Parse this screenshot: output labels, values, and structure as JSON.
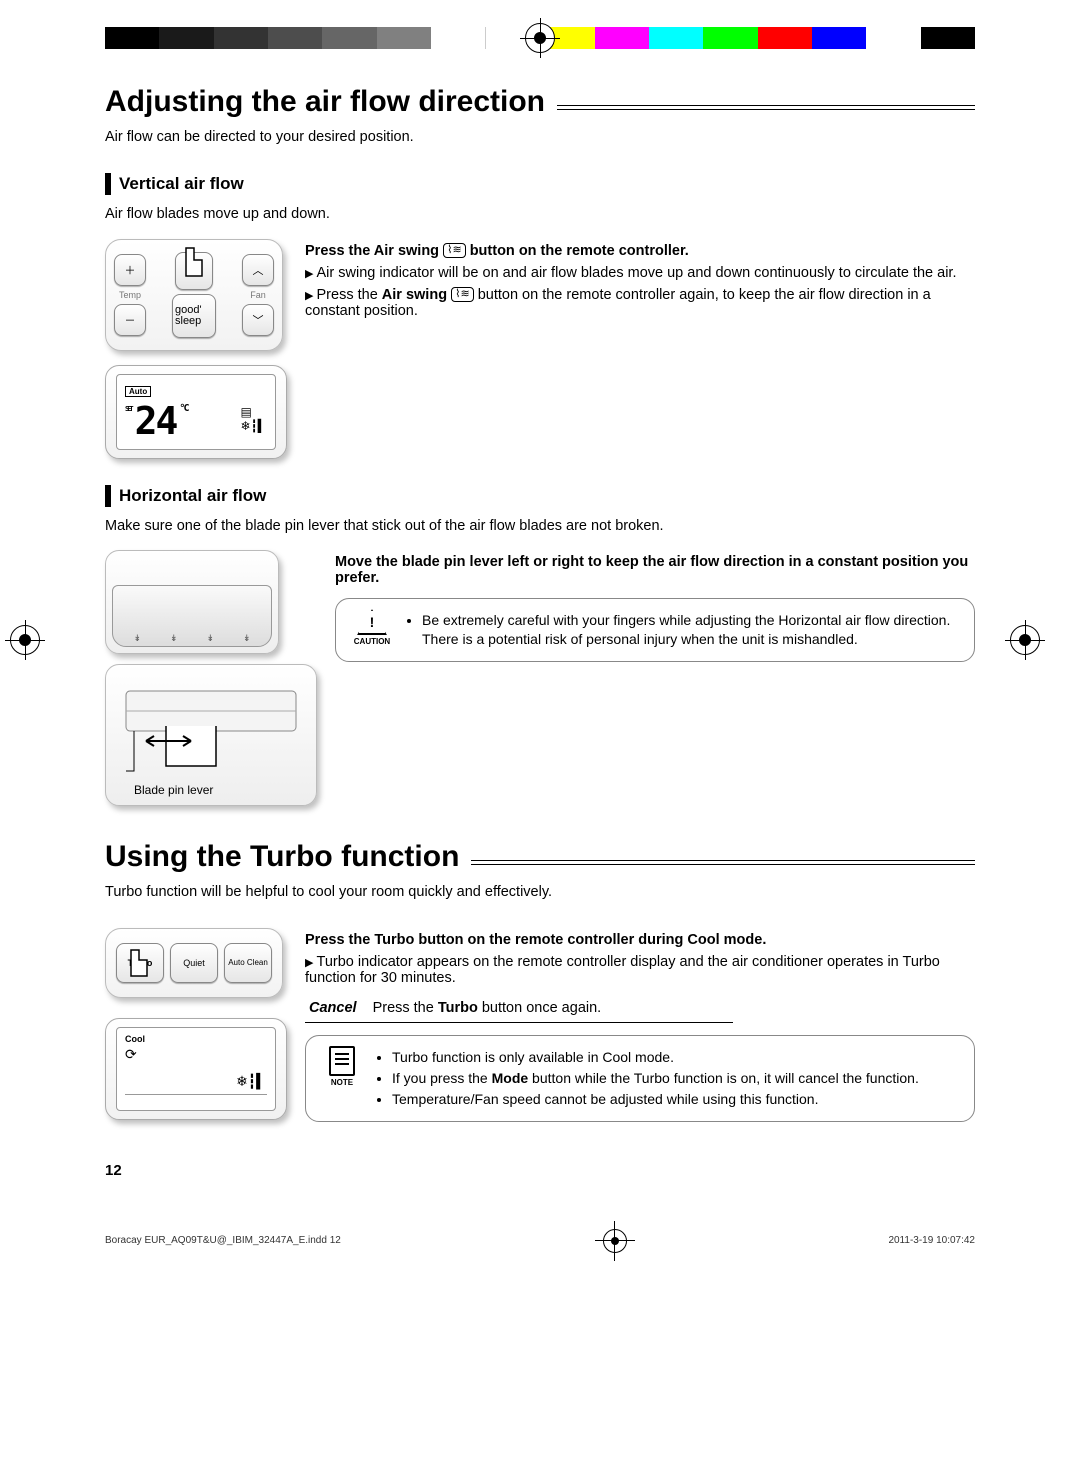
{
  "colorbar": [
    "#000",
    "#1a1a1a",
    "#333",
    "#4d4d4d",
    "#666",
    "#808080",
    "#fff",
    "#fff",
    "#ff0",
    "#f0f",
    "#0ff",
    "#0f0",
    "#f00",
    "#00f",
    "#fff",
    "#000"
  ],
  "h1a": "Adjusting the air flow direction",
  "intro_a": "Air flow can be directed to your desired position.",
  "sub_vert": "Vertical air flow",
  "vert_desc": "Air flow blades move up and down.",
  "remote": {
    "temp": "Temp",
    "fan": "Fan",
    "goodsleep": "good' sleep",
    "auto": "Auto",
    "set": "SET",
    "temp_val": "24",
    "degc": "°C"
  },
  "vert_instr_lead_a": "Press the ",
  "vert_instr_lead_b": "Air swing",
  "vert_instr_lead_c": " button on the remote controller.",
  "vert_b1": "Air swing indicator will be on and air flow blades move up and down continuously to circulate the air.",
  "vert_b2a": "Press the ",
  "vert_b2b": "Air swing",
  "vert_b2c": " button on the remote controller again, to keep the air flow direction in a constant position.",
  "sub_horiz": "Horizontal air flow",
  "horiz_desc": "Make sure one of the blade pin lever that stick out of the air flow blades are not broken.",
  "horiz_instr": "Move the blade pin lever left or right to keep the air flow direction in a constant position you prefer.",
  "blade_caption": "Blade pin lever",
  "caution_label": "CAUTION",
  "caution_1": "Be extremely careful with your fingers while adjusting the Horizontal air flow direction.",
  "caution_2": "There is a potential risk of personal injury when the unit is mishandled.",
  "h1b": "Using the Turbo function",
  "intro_b": "Turbo function will be helpful to cool your room quickly and effectively.",
  "turbo_btns": {
    "turbo": "Turbo",
    "quiet": "Quiet",
    "auto": "Auto Clean"
  },
  "lcd2_mode": "Cool",
  "turbo_lead_a": "Press the ",
  "turbo_lead_b": "Turbo",
  "turbo_lead_c": " button on the remote controller during Cool mode.",
  "turbo_b1": "Turbo indicator appears on the remote controller display and the air conditioner operates in Turbo function for 30 minutes.",
  "cancel_k": "Cancel",
  "cancel_v_a": "Press the ",
  "cancel_v_b": "Turbo",
  "cancel_v_c": " button once again.",
  "note_label": "NOTE",
  "note_1": "Turbo function is only available in Cool mode.",
  "note_2a": "If you press the ",
  "note_2b": "Mode",
  "note_2c": " button while the Turbo function is on, it will cancel the function.",
  "note_3": "Temperature/Fan speed cannot be adjusted while using this function.",
  "page_num": "12",
  "footer_file": "Boracay EUR_AQ09T&U@_IBIM_32447A_E.indd   12",
  "footer_date": "2011-3-19   10:07:42"
}
